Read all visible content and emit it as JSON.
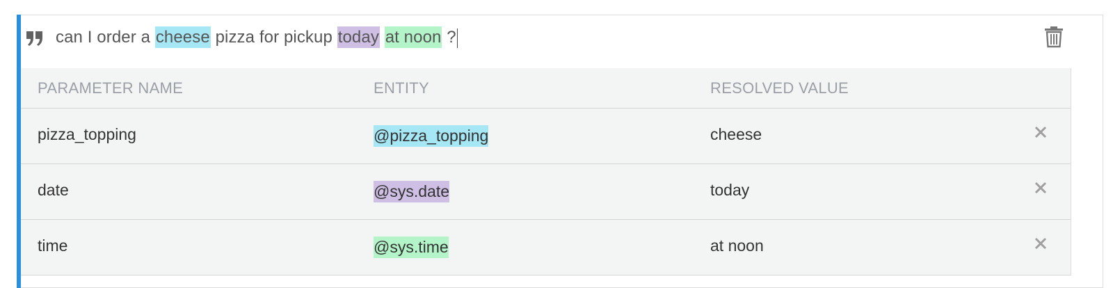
{
  "phrase": {
    "segments": {
      "s0": "can I order a ",
      "s1": "cheese",
      "s2": " pizza for pickup ",
      "s3": "today",
      "s4": " ",
      "s5": "at noon",
      "s6": " ?"
    },
    "quote_icon": "format-quote-icon",
    "delete_icon": "trash-icon"
  },
  "colors": {
    "accent": "#2a8fdc",
    "topping": "#a6e7f6",
    "date": "#d0bfe5",
    "time": "#b3f4c8"
  },
  "table": {
    "headers": {
      "param": "PARAMETER NAME",
      "entity": "ENTITY",
      "value": "RESOLVED VALUE"
    },
    "rows": [
      {
        "param": "pizza_topping",
        "entity": "@pizza_topping",
        "value": "cheese"
      },
      {
        "param": "date",
        "entity": "@sys.date",
        "value": "today"
      },
      {
        "param": "time",
        "entity": "@sys.time",
        "value": "at noon"
      }
    ],
    "remove_icon": "close-icon"
  }
}
